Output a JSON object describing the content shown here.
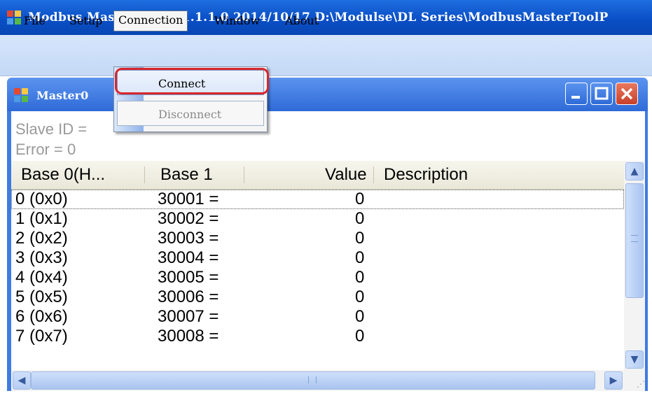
{
  "app": {
    "title": "Modbus Master Tool V1.1.1.0  2014/10/17  D:\\Modulse\\DL Series\\ModbusMasterToolP"
  },
  "menu": {
    "file": "File",
    "setup": "Setup",
    "connection": "Connection",
    "window": "Window",
    "about": "About"
  },
  "dropdown": {
    "connect": "Connect",
    "disconnect": "Disconnect"
  },
  "child": {
    "title": "Master0"
  },
  "info": {
    "slave_id": "Slave ID = ",
    "error": "Error = 0"
  },
  "columns": [
    "Base 0(H...",
    "Base 1",
    "Value",
    "Description"
  ],
  "rows": [
    {
      "base0": "0 (0x0)",
      "base1": "30001  =",
      "value": "0",
      "description": ""
    },
    {
      "base0": "1 (0x1)",
      "base1": "30002  =",
      "value": "0",
      "description": ""
    },
    {
      "base0": "2 (0x2)",
      "base1": "30003  =",
      "value": "0",
      "description": ""
    },
    {
      "base0": "3 (0x3)",
      "base1": "30004  =",
      "value": "0",
      "description": ""
    },
    {
      "base0": "4 (0x4)",
      "base1": "30005  =",
      "value": "0",
      "description": ""
    },
    {
      "base0": "5 (0x5)",
      "base1": "30006  =",
      "value": "0",
      "description": ""
    },
    {
      "base0": "6 (0x6)",
      "base1": "30007  =",
      "value": "0",
      "description": ""
    },
    {
      "base0": "7 (0x7)",
      "base1": "30008  =",
      "value": "0",
      "description": ""
    }
  ],
  "colors": {
    "title_blue": "#0a4fc6",
    "highlight_red": "#d7262e",
    "close_red": "#c8402a"
  },
  "icons": [
    "app-icon",
    "minimize-icon",
    "maximize-icon",
    "close-icon",
    "scroll-up-icon",
    "scroll-down-icon",
    "scroll-left-icon",
    "scroll-right-icon"
  ]
}
